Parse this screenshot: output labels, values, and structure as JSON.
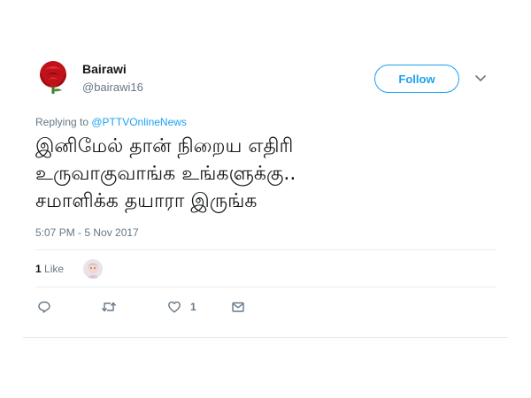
{
  "user": {
    "display_name": "Bairawi",
    "handle": "@bairawi16",
    "avatar_icon": "red-rose-icon"
  },
  "follow_label": "Follow",
  "more_icon": "chevron-down-icon",
  "reply_context": {
    "prefix": "Replying to ",
    "mention": "@PTTVOnlineNews"
  },
  "tweet": {
    "lines": [
      "இனிமேல் தான் நிறைய எதிரி",
      "உருவாகுவாங்க உங்களுக்கு..",
      "சமாளிக்க தயாரா இருங்க"
    ],
    "timestamp": "5:07 PM - 5 Nov 2017"
  },
  "stats": {
    "like_count": "1",
    "like_label": "Like"
  },
  "actions": {
    "reply_icon": "reply-icon",
    "retweet_icon": "retweet-icon",
    "like_icon": "heart-icon",
    "like_count": "1",
    "dm_icon": "envelope-icon"
  },
  "colors": {
    "accent": "#1da1f2",
    "muted": "#657786",
    "text": "#14171a"
  }
}
